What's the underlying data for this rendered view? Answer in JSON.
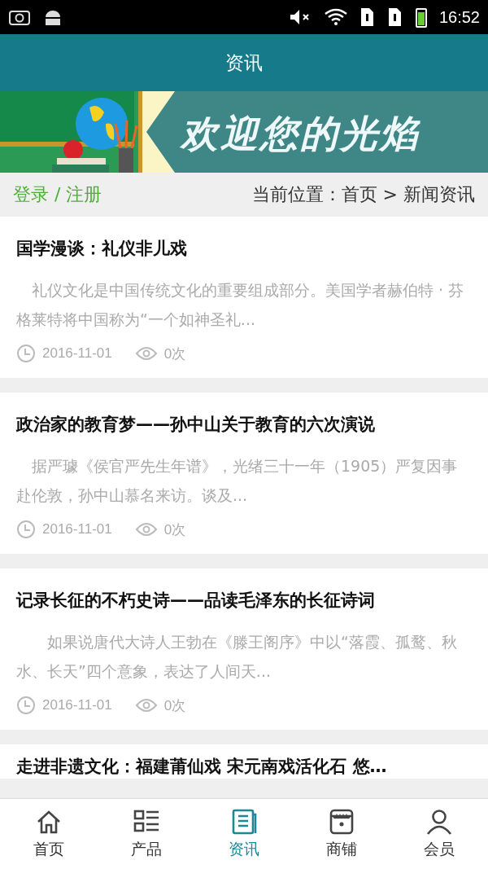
{
  "status_bar": {
    "time": "16:52"
  },
  "header": {
    "title": "资讯"
  },
  "banner": {
    "kind": "picture",
    "caption": "欢迎您的光焰"
  },
  "breadcrumb_bar": {
    "login": "登录 / 注册",
    "location_label": "当前位置：",
    "path": "首页 > 新闻资讯"
  },
  "articles": [
    {
      "title": "国学漫谈：礼仪非儿戏",
      "summary": "礼仪文化是中国传统文化的重要组成部分。美国学者赫伯特 · 芬格莱特将中国称为“一个如神圣礼...",
      "date": "2016-11-01",
      "views": "0次"
    },
    {
      "title": "政治家的教育梦——孙中山关于教育的六次演说",
      "summary": "据严璩《侯官严先生年谱》，光绪三十一年（1905）严复因事赴伦敦，孙中山慕名来访。谈及...",
      "date": "2016-11-01",
      "views": "0次"
    },
    {
      "title": "记录长征的不朽史诗——品读毛泽东的长征诗词",
      "summary": "　如果说唐代大诗人王勃在《滕王阁序》中以“落霞、孤鹜、秋水、长天”四个意象，表达了人间天...",
      "date": "2016-11-01",
      "views": "0次"
    },
    {
      "title": "走进非遗文化：福建莆仙戏 宋元南戏活化石 悠…"
    }
  ],
  "tab_bar": [
    {
      "kind": "home",
      "label": "首页",
      "selected": false
    },
    {
      "kind": "products",
      "label": "产品",
      "selected": false
    },
    {
      "kind": "news",
      "label": "资讯",
      "selected": true
    },
    {
      "kind": "shop",
      "label": "商铺",
      "selected": false
    },
    {
      "kind": "member",
      "label": "会员",
      "selected": false
    }
  ]
}
